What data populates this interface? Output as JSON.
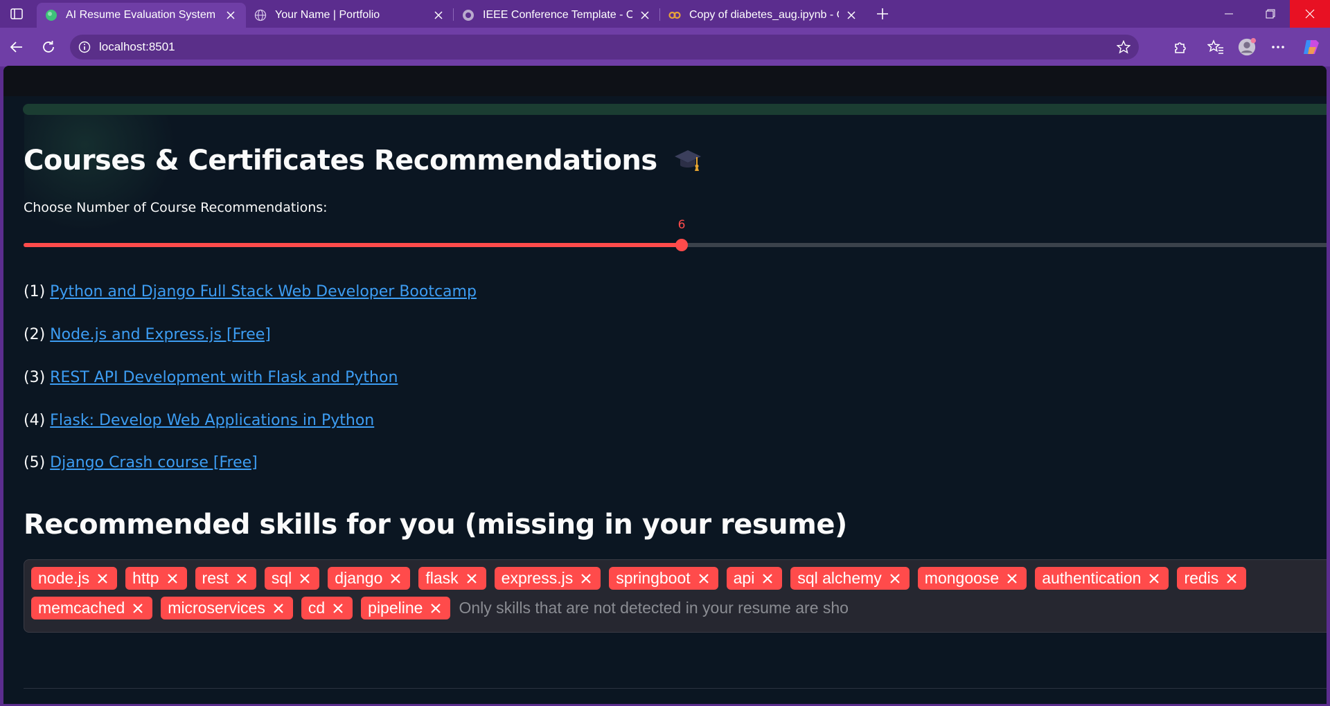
{
  "browser": {
    "tabs": [
      {
        "title": "AI Resume Evaluation System",
        "icon": "streamlit-favicon",
        "active": true
      },
      {
        "title": "Your Name | Portfolio",
        "icon": "globe-favicon",
        "active": false
      },
      {
        "title": "IEEE Conference Template - Online",
        "icon": "overleaf-favicon",
        "active": false
      },
      {
        "title": "Copy of diabetes_aug.ipynb - Col",
        "icon": "colab-favicon",
        "active": false
      }
    ],
    "url": "localhost:8501"
  },
  "courses_section": {
    "heading": "Courses & Certificates Recommendations",
    "heading_icon": "graduation-cap-emoji",
    "slider_label": "Choose Number of Course Recommendations:",
    "slider_value": "6",
    "slider_min": 1,
    "slider_max": 11,
    "courses": [
      {
        "number": "(1)",
        "title": "Python and Django Full Stack Web Developer Bootcamp"
      },
      {
        "number": "(2)",
        "title": "Node.js and Express.js [Free]"
      },
      {
        "number": "(3)",
        "title": "REST API Development with Flask and Python"
      },
      {
        "number": "(4)",
        "title": "Flask: Develop Web Applications in Python"
      },
      {
        "number": "(5)",
        "title": "Django Crash course [Free]"
      }
    ]
  },
  "skills_section": {
    "heading": "Recommended skills for you (missing in your resume)",
    "skills": [
      "node.js",
      "http",
      "rest",
      "sql",
      "django",
      "flask",
      "express.js",
      "springboot",
      "api",
      "sql alchemy",
      "mongoose",
      "authentication",
      "redis",
      "memcached",
      "microservices",
      "cd",
      "pipeline"
    ],
    "placeholder": "Only skills that are not detected in your resume are sho"
  },
  "colors": {
    "accent": "#ff4b4b",
    "link": "#3d9df3",
    "browser_frame": "#5b2d8e",
    "page_bg": "#0b1622"
  }
}
